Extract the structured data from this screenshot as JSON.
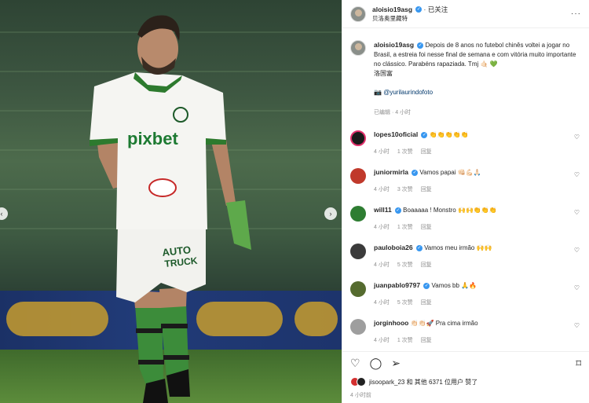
{
  "post": {
    "username": "aloisio19asg",
    "follow_label": "已关注",
    "location": "贝洛奥里藏特",
    "more_label": "···",
    "caption_line1": "Depois de 8 anos no futebol chinês voltei a jogar no Brasil, a estreia foi nesse final de semana e com vitória muito importante no clássico. Parabéns rapaziada. Tmj",
    "caption_line2": "洛国富",
    "photo_credit": "@yurilaurindofoto",
    "edited_time": "已编辑 · 4 小时"
  },
  "comments": [
    {
      "user": "lopes10oficial",
      "text": "👏👏👏👏👏",
      "time": "4 小时",
      "likes": "1 次赞",
      "reply": "回复",
      "avatar_color": "#1a1a1a"
    },
    {
      "user": "juniormirla",
      "text": "Vamos papai 👊🏻💪🏻🙏🏻",
      "time": "4 小时",
      "likes": "3 次赞",
      "reply": "回复",
      "avatar_color": "#c0392b"
    },
    {
      "user": "will11",
      "text": "Boaaaaa ! Monstro 🙌🙌👏👏👏",
      "time": "4 小时",
      "likes": "1 次赞",
      "reply": "回复",
      "avatar_color": "#2e7d32"
    },
    {
      "user": "pauloboia26",
      "text": "Vamos meu irmão 🙌🙌",
      "time": "4 小时",
      "likes": "5 次赞",
      "reply": "回复",
      "avatar_color": "#3b3b3b"
    },
    {
      "user": "juanpablo9797",
      "text": "Vamos bb 🙏🔥",
      "time": "4 小时",
      "likes": "5 次赞",
      "reply": "回复",
      "avatar_color": "#556b2f"
    },
    {
      "user": "jorginhooo",
      "text": "👏🏻👏🏻🚀 Pra cima irmão",
      "time": "4 小时",
      "likes": "1 次赞",
      "reply": "回复",
      "avatar_color": "#9e9e9e"
    }
  ],
  "likes_bar": {
    "text": "jisoopark_23 和 其他 6371 位用户 赞了",
    "time": "4 小时前"
  },
  "colors": {
    "verified": "#3897f0",
    "meta_grey": "#8e8e8e",
    "link": "#00376b"
  },
  "icons": {
    "like": "heart-outline-icon",
    "comment": "comment-bubble-icon",
    "share": "paper-plane-icon",
    "save": "bookmark-icon",
    "prev": "chevron-left-icon",
    "next": "chevron-right-icon"
  }
}
